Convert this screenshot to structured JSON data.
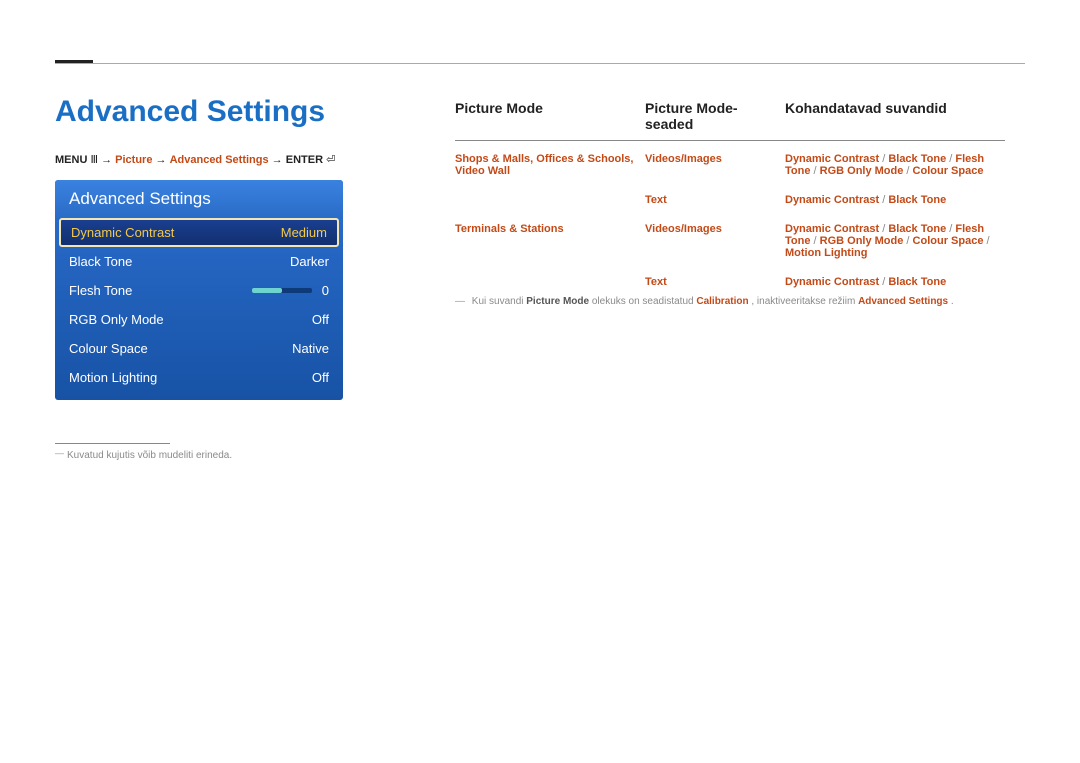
{
  "title": "Advanced Settings",
  "breadcrumb": {
    "menu": "MENU",
    "arrow": "→",
    "picture": "Picture",
    "adv": "Advanced Settings",
    "enter": "ENTER"
  },
  "osd": {
    "title": "Advanced Settings",
    "items": [
      {
        "label": "Dynamic Contrast",
        "value": "Medium",
        "selected": true
      },
      {
        "label": "Black Tone",
        "value": "Darker"
      },
      {
        "label": "Flesh Tone",
        "value": "0",
        "slider": true
      },
      {
        "label": "RGB Only Mode",
        "value": "Off"
      },
      {
        "label": "Colour Space",
        "value": "Native"
      },
      {
        "label": "Motion Lighting",
        "value": "Off"
      }
    ]
  },
  "footnote_left": "Kuvatud kujutis võib mudeliti erineda.",
  "table": {
    "headers": {
      "c1": "Picture Mode",
      "c2": "Picture Mode-seaded",
      "c3": "Kohandatavad suvandid"
    },
    "rows": [
      {
        "c1": "Shops & Malls, Offices & Schools, Video Wall",
        "c2": "Videos/Images",
        "c3_parts": [
          "Dynamic Contrast",
          " / ",
          "Black Tone",
          " / ",
          "Flesh Tone",
          " / ",
          "RGB Only Mode",
          " / ",
          "Colour Space"
        ]
      },
      {
        "c1": "",
        "c2": "Text",
        "c3_parts": [
          "Dynamic Contrast",
          " / ",
          "Black Tone"
        ]
      },
      {
        "c1": "Terminals & Stations",
        "c2": "Videos/Images",
        "c3_parts": [
          "Dynamic Contrast",
          " / ",
          "Black Tone",
          " / ",
          "Flesh Tone",
          " / ",
          "RGB Only Mode",
          " / ",
          "Colour Space",
          " / ",
          "Motion Lighting"
        ]
      },
      {
        "c1": "",
        "c2": "Text",
        "c3_parts": [
          "Dynamic Contrast",
          " / ",
          "Black Tone"
        ]
      }
    ]
  },
  "footnote_right": {
    "pre": "Kui suvandi ",
    "pm": "Picture Mode",
    "mid": " olekuks on seadistatud ",
    "cal": "Calibration",
    "mid2": ", inaktiveeritakse režiim ",
    "adv": "Advanced Settings",
    "end": "."
  }
}
